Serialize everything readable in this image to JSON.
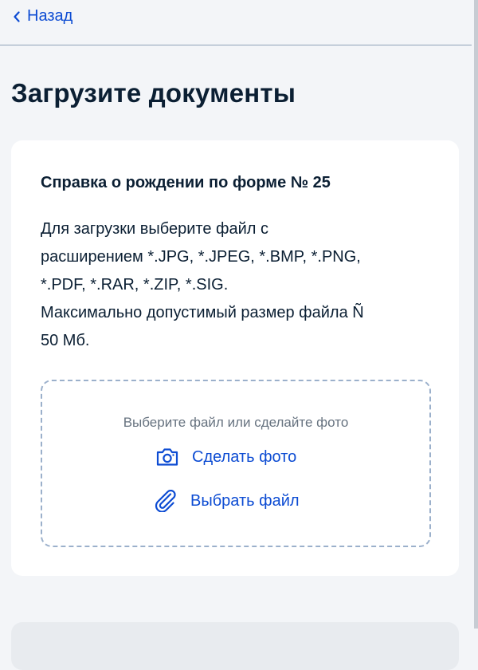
{
  "nav": {
    "back_label": "Назад",
    "back_icon": "chevron-left-icon"
  },
  "page": {
    "title": "Загрузите документы"
  },
  "document": {
    "title": "Справка о рождении по форме № 25",
    "description_lines": [
      "Для загрузки выберите файл с",
      "расширением *.JPG, *.JPEG, *.BMP, *.PNG,",
      "*.PDF, *.RAR, *.ZIP, *.SIG.",
      "Максимально допустимый размер файла Ñ",
      "50 Мб."
    ]
  },
  "upload": {
    "hint": "Выберите файл или сделайте фото",
    "take_photo_label": "Сделать фото",
    "take_photo_icon": "camera-icon",
    "choose_file_label": "Выбрать файл",
    "choose_file_icon": "paperclip-icon"
  },
  "colors": {
    "accent": "#0d4cd3",
    "text": "#0b1f33",
    "muted": "#66727f",
    "background": "#f3f5f8",
    "card": "#ffffff",
    "dashed_border": "#9bb0cb"
  }
}
